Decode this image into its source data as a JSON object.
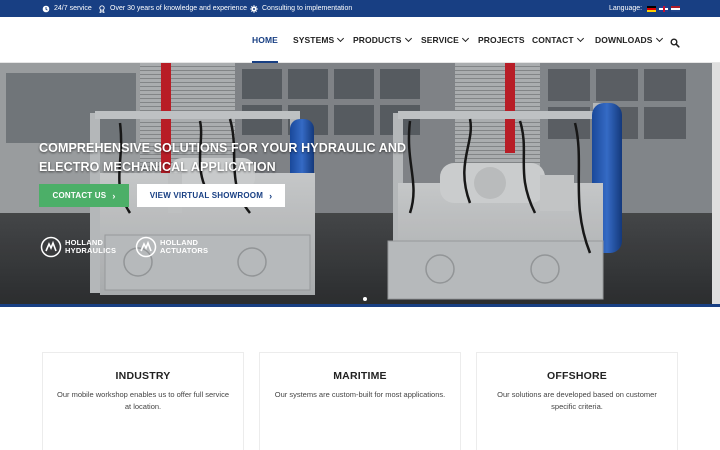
{
  "topbar": {
    "items": [
      {
        "icon": "clock-icon",
        "label": "24/7 service"
      },
      {
        "icon": "certificate-icon",
        "label": "Over 30 years of knowledge and experience"
      },
      {
        "icon": "gear-icon",
        "label": "Consulting to implementation"
      }
    ],
    "language_label": "Language:",
    "languages": [
      "German",
      "English",
      "Dutch"
    ]
  },
  "nav": {
    "items": [
      {
        "label": "HOME",
        "active": true
      },
      {
        "label": "SYSTEMS",
        "dropdown": true
      },
      {
        "label": "PRODUCTS",
        "dropdown": true
      },
      {
        "label": "SERVICE",
        "dropdown": true
      },
      {
        "label": "PROJECTS"
      },
      {
        "label": "CONTACT",
        "dropdown": true
      },
      {
        "label": "DOWNLOADS",
        "dropdown": true
      }
    ],
    "search_icon": "search-icon"
  },
  "hero": {
    "title": "COMPREHENSIVE SOLUTIONS FOR YOUR HYDRAULIC AND ELECTRO MECHANICAL APPLICATION",
    "contact_button": "CONTACT US",
    "showroom_button": "VIEW VIRTUAL SHOWROOM",
    "logos": [
      {
        "line1": "HOLLAND",
        "line2": "HYDRAULICS"
      },
      {
        "line1": "HOLLAND",
        "line2": "ACTUATORS"
      }
    ]
  },
  "cards": [
    {
      "title": "INDUSTRY",
      "text": "Our mobile workshop enables us to offer full service at location."
    },
    {
      "title": "MARITIME",
      "text": "Our systems are custom-built for most applications."
    },
    {
      "title": "OFFSHORE",
      "text": "Our solutions are developed based on customer specific criteria."
    }
  ],
  "colors": {
    "brand_blue": "#183f83",
    "contact_green": "#4caf68"
  }
}
